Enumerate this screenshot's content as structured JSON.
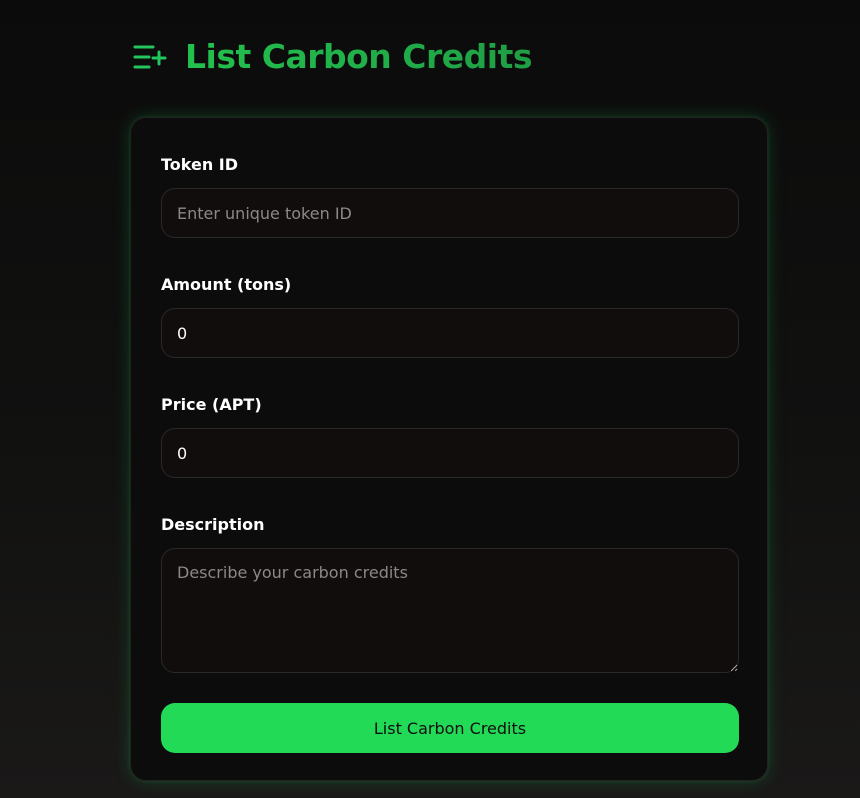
{
  "header": {
    "icon": "list-add-icon",
    "title": "List Carbon Credits",
    "accent_color": "#22c55e"
  },
  "form": {
    "token_id": {
      "label": "Token ID",
      "value": "",
      "placeholder": "Enter unique token ID"
    },
    "amount": {
      "label": "Amount (tons)",
      "value": "0",
      "placeholder": ""
    },
    "price": {
      "label": "Price (APT)",
      "value": "0",
      "placeholder": ""
    },
    "description": {
      "label": "Description",
      "value": "",
      "placeholder": "Describe your carbon credits"
    },
    "submit_label": "List Carbon Credits",
    "submit_color": "#22da56"
  }
}
